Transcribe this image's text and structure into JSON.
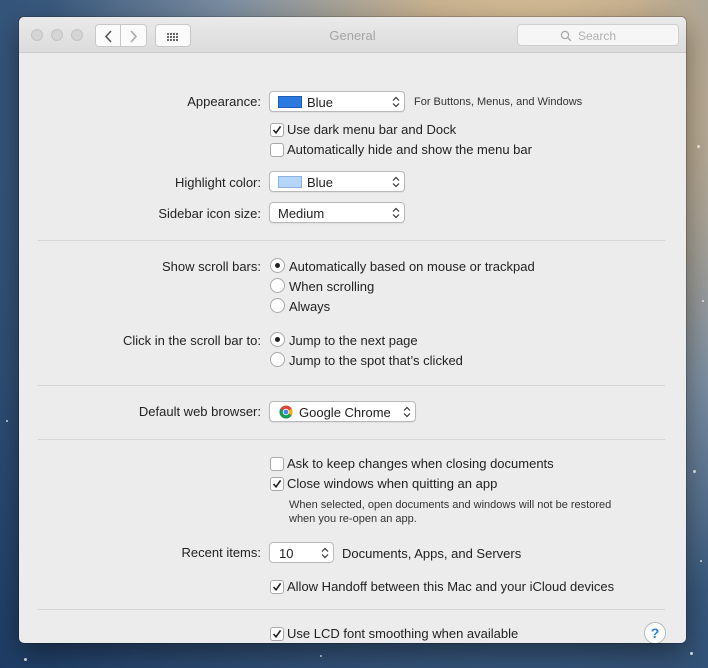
{
  "window": {
    "title": "General"
  },
  "search": {
    "placeholder": "Search"
  },
  "appearance": {
    "label": "Appearance:",
    "value": "Blue",
    "swatch_color": "#2a7ae2",
    "suffix": "For Buttons, Menus, and Windows"
  },
  "dark_menu": {
    "label": "Use dark menu bar and Dock",
    "checked": true
  },
  "autohide_menu": {
    "label": "Automatically hide and show the menu bar",
    "checked": false
  },
  "highlight": {
    "label": "Highlight color:",
    "value": "Blue",
    "swatch_color": "#b5d5fb"
  },
  "sidebar_icon": {
    "label": "Sidebar icon size:",
    "value": "Medium"
  },
  "scroll_bars": {
    "label": "Show scroll bars:",
    "options": [
      {
        "label": "Automatically based on mouse or trackpad",
        "selected": true
      },
      {
        "label": "When scrolling",
        "selected": false
      },
      {
        "label": "Always",
        "selected": false
      }
    ]
  },
  "click_scroll": {
    "label": "Click in the scroll bar to:",
    "options": [
      {
        "label": "Jump to the next page",
        "selected": true
      },
      {
        "label": "Jump to the spot that’s clicked",
        "selected": false
      }
    ]
  },
  "browser": {
    "label": "Default web browser:",
    "value": "Google Chrome"
  },
  "ask_keep": {
    "label": "Ask to keep changes when closing documents",
    "checked": false
  },
  "close_windows": {
    "label": "Close windows when quitting an app",
    "checked": true,
    "note_line1": "When selected, open documents and windows will not be restored",
    "note_line2": "when you re-open an app."
  },
  "recent": {
    "label": "Recent items:",
    "value": "10",
    "suffix": "Documents, Apps, and Servers"
  },
  "handoff": {
    "label": "Allow Handoff between this Mac and your iCloud devices",
    "checked": true
  },
  "lcd": {
    "label": "Use LCD font smoothing when available",
    "checked": true
  },
  "help": {
    "label": "?"
  }
}
